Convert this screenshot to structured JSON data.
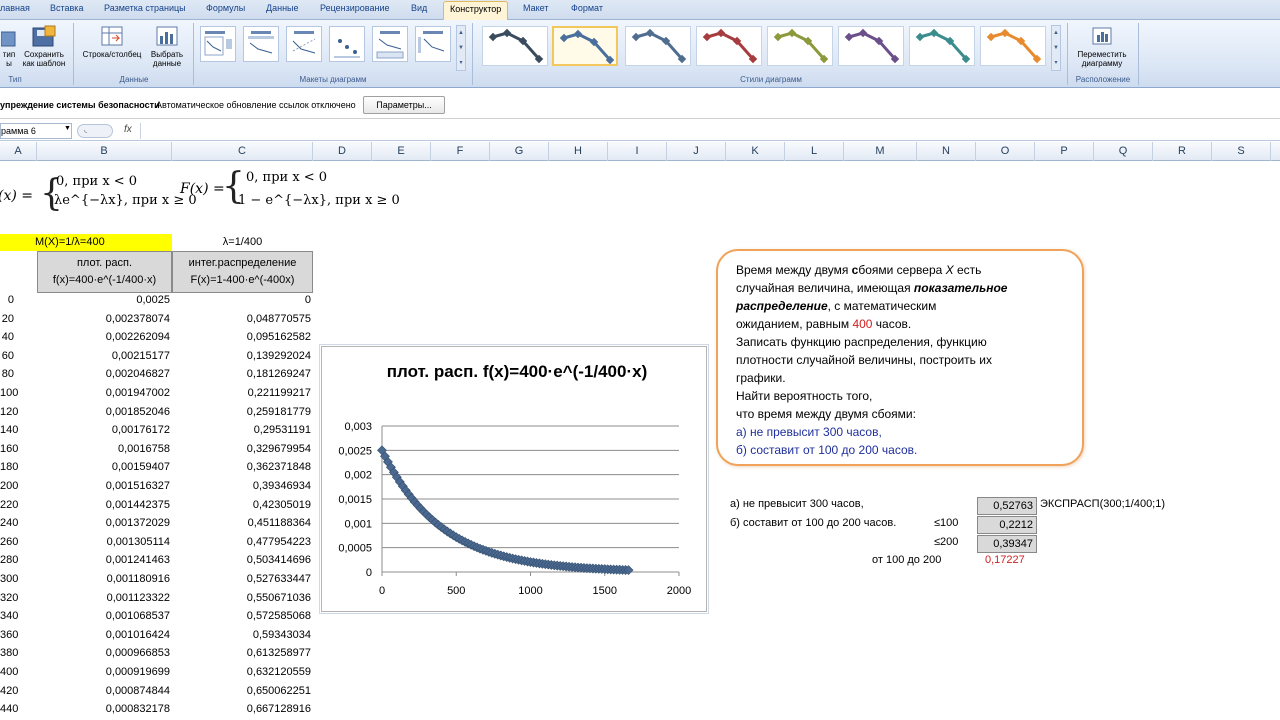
{
  "ribbon": {
    "tabs": [
      "лавная",
      "Вставка",
      "Разметка страницы",
      "Формулы",
      "Данные",
      "Рецензирование",
      "Вид",
      "Конструктор",
      "Макет",
      "Формат"
    ],
    "active_tab": "Конструктор",
    "buttons": {
      "change_type": "тип\nы",
      "save_template": "Сохранить\nкак шаблон",
      "row_col": "Строка/столбец",
      "select_data": "Выбрать\nданные",
      "move_chart": "Переместить\nдиаграмму"
    },
    "groups": {
      "type": "Тип",
      "data": "Данные",
      "layouts": "Макеты диаграмм",
      "styles": "Стили диаграмм",
      "location": "Расположение"
    },
    "style_colors": [
      "#3b4b5e",
      "#4a6f9c",
      "#4f6e8f",
      "#a73c3f",
      "#8c9a3b",
      "#6a4f8a",
      "#3b8c8c",
      "#e88a2f"
    ]
  },
  "security_bar": {
    "label": "упреждение системы безопасности",
    "message": "Автоматическое обновление ссылок отключено",
    "button": "Параметры..."
  },
  "formula_bar": {
    "name_box": "рамма 6",
    "fx": "fx",
    "formula": ""
  },
  "columns": [
    "A",
    "B",
    "C",
    "D",
    "E",
    "F",
    "G",
    "H",
    "I",
    "J",
    "K",
    "L",
    "M",
    "N",
    "O",
    "P",
    "Q",
    "R",
    "S"
  ],
  "sheet": {
    "formula_f": {
      "lhs": "(x) =",
      "case1": "0,  при x < 0",
      "case2": "λe^{−λx}, при x ≥ 0"
    },
    "formula_F": {
      "lhs": "F(x) =",
      "case1": "0,  при x < 0",
      "case2": "1 − e^{−λx}, при x ≥ 0"
    },
    "mean_label": "M(X)=1/λ=400",
    "lambda_label": "λ=1/400",
    "header_b1": "плот. расп.",
    "header_b2": "f(x)=400·e^(-1/400·x)",
    "header_c1": "интег.распределение",
    "header_c2": "F(x)=1-400·e^(-400x)",
    "rows": [
      {
        "a": "0",
        "b": "0,0025",
        "c": "0"
      },
      {
        "a": "20",
        "b": "0,002378074",
        "c": "0,048770575"
      },
      {
        "a": "40",
        "b": "0,002262094",
        "c": "0,095162582"
      },
      {
        "a": "60",
        "b": "0,00215177",
        "c": "0,139292024"
      },
      {
        "a": "80",
        "b": "0,002046827",
        "c": "0,181269247"
      },
      {
        "a": "100",
        "b": "0,001947002",
        "c": "0,221199217"
      },
      {
        "a": "120",
        "b": "0,001852046",
        "c": "0,259181779"
      },
      {
        "a": "140",
        "b": "0,00176172",
        "c": "0,29531191"
      },
      {
        "a": "160",
        "b": "0,0016758",
        "c": "0,329679954"
      },
      {
        "a": "180",
        "b": "0,00159407",
        "c": "0,362371848"
      },
      {
        "a": "200",
        "b": "0,001516327",
        "c": "0,39346934"
      },
      {
        "a": "220",
        "b": "0,001442375",
        "c": "0,42305019"
      },
      {
        "a": "240",
        "b": "0,001372029",
        "c": "0,451188364"
      },
      {
        "a": "260",
        "b": "0,001305114",
        "c": "0,477954223"
      },
      {
        "a": "280",
        "b": "0,001241463",
        "c": "0,503414696"
      },
      {
        "a": "300",
        "b": "0,001180916",
        "c": "0,527633447"
      },
      {
        "a": "320",
        "b": "0,001123322",
        "c": "0,550671036"
      },
      {
        "a": "340",
        "b": "0,001068537",
        "c": "0,572585068"
      },
      {
        "a": "360",
        "b": "0,001016424",
        "c": "0,59343034"
      },
      {
        "a": "380",
        "b": "0,000966853",
        "c": "0,613258977"
      },
      {
        "a": "400",
        "b": "0,000919699",
        "c": "0,632120559"
      },
      {
        "a": "420",
        "b": "0,000874844",
        "c": "0,650062251"
      },
      {
        "a": "440",
        "b": "0,000832178",
        "c": "0,667128916"
      }
    ],
    "answers": {
      "a_label": "а) не превысит 300 часов,",
      "a_value": "0,52763",
      "a_formula": "ЭКСПРАСП(300;1/400;1)",
      "b_label": "б) составит от 100 до 200 часов.",
      "le100": "≤100",
      "le100_value": "0,2212",
      "le200": "≤200",
      "le200_value": "0,39347",
      "between_label": "от 100 до 200",
      "between_value": "0,17227"
    }
  },
  "task": {
    "l1_a": "Время между двумя ",
    "l1_b": "с",
    "l1_c": "боями сервера ",
    "l1_x": "X",
    "l1_d": " есть",
    "l2_a": "случайная величина, имеющая ",
    "l2_b": "показательное",
    "l3_a": "распределение",
    "l3_b": ", с математическим",
    "l4_a": "ожиданием, равным ",
    "l4_b": "400",
    "l4_c": " часов.",
    "l5": "Записать функцию распределения, функцию",
    "l6": "плотности случайной величины, построить их",
    "l7": "графики.",
    "l8": "Найти вероятность того,",
    "l9": "что время между двумя сбоями:",
    "l10": "а) не превысит 300 часов,",
    "l11": "б) составит  от 100 до 200 часов."
  },
  "chart_data": {
    "type": "scatter",
    "title": "плот. расп. f(x)=400·e^(-1/400·x)",
    "xlabel": "",
    "ylabel": "",
    "xlim": [
      0,
      2000
    ],
    "ylim": [
      0,
      0.003
    ],
    "xticks": [
      0,
      500,
      1000,
      1500,
      2000
    ],
    "xtick_labels": [
      "0",
      "500",
      "1000",
      "1500",
      "2000"
    ],
    "yticks": [
      0,
      0.0005,
      0.001,
      0.0015,
      0.002,
      0.0025,
      0.003
    ],
    "ytick_labels": [
      "0",
      "0,0005",
      "0,001",
      "0,0015",
      "0,002",
      "0,0025",
      "0,003"
    ],
    "grid": true,
    "series_color": "#4a6890",
    "x": [
      0,
      20,
      40,
      60,
      80,
      100,
      120,
      140,
      160,
      180,
      200,
      220,
      240,
      260,
      280,
      300,
      320,
      340,
      360,
      380,
      400,
      420,
      440,
      460,
      480,
      500,
      520,
      540,
      560,
      580,
      600,
      620,
      640,
      660,
      680,
      700,
      720,
      740,
      760,
      780,
      800,
      820,
      840,
      860,
      880,
      900,
      920,
      940,
      960,
      980,
      1000,
      1020,
      1040,
      1060,
      1080,
      1100,
      1120,
      1140,
      1160,
      1180,
      1200,
      1220,
      1240,
      1260,
      1280,
      1300,
      1320,
      1340,
      1360,
      1380,
      1400,
      1420,
      1440,
      1460,
      1480,
      1500,
      1520,
      1540,
      1560,
      1580,
      1600,
      1620,
      1640,
      1660
    ],
    "y": [
      0.0025,
      0.002378,
      0.002262,
      0.002152,
      0.002047,
      0.001947,
      0.001852,
      0.001762,
      0.001676,
      0.001594,
      0.001516,
      0.001442,
      0.001372,
      0.001305,
      0.001241,
      0.001181,
      0.001123,
      0.001069,
      0.001016,
      0.000967,
      0.00092,
      0.000875,
      0.000832,
      0.000792,
      0.000753,
      0.000716,
      0.000681,
      0.000648,
      0.000617,
      0.000587,
      0.000558,
      0.000531,
      0.000505,
      0.00048,
      0.000457,
      0.000435,
      0.000413,
      0.000393,
      0.000374,
      0.000356,
      0.000339,
      0.000322,
      0.000306,
      0.000291,
      0.000277,
      0.000264,
      0.000251,
      0.000239,
      0.000227,
      0.000216,
      0.000205,
      0.000195,
      0.000186,
      0.000177,
      0.000168,
      0.00016,
      0.000152,
      0.000145,
      0.000138,
      0.000131,
      0.000125,
      0.000119,
      0.000113,
      0.000107,
      0.000102,
      9.7e-05,
      9.2e-05,
      8.8e-05,
      8.3e-05,
      7.9e-05,
      7.5e-05,
      7.2e-05,
      6.8e-05,
      6.5e-05,
      6.2e-05,
      5.9e-05,
      5.6e-05,
      5.3e-05,
      5e-05,
      4.8e-05,
      4.6e-05,
      4.3e-05,
      4.1e-05,
      3.9e-05
    ]
  }
}
